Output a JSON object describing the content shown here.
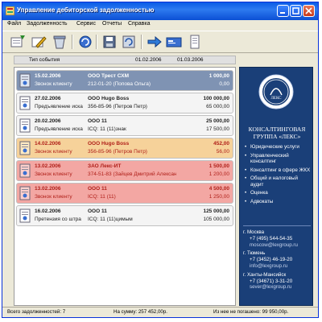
{
  "window": {
    "title": "Управление дебиторской задолженностью"
  },
  "menu": [
    "Файл",
    "Задолженность",
    "Сервис",
    "Отчеты",
    "Справка"
  ],
  "toolbar": {
    "icons": [
      "add-icon",
      "edit-icon",
      "delete-icon",
      "refresh-icon",
      "save-icon",
      "undo-icon",
      "export-icon",
      "card-icon",
      "print-icon"
    ]
  },
  "list_header": {
    "type_label": "Тип события",
    "date_from": "01.02.2006",
    "date_to": "01.03.2006"
  },
  "events": [
    {
      "date": "15.02.2006",
      "org": "ООО Трест СХМ",
      "amount": "1 000,00",
      "desc": "Звонок клиенту",
      "contact": "212-01-20 (Попова Ольга)",
      "amount2": "0,00",
      "status": "selected"
    },
    {
      "date": "27.02.2006",
      "org": "ООО Hugo Boss",
      "amount": "100 000,00",
      "desc": "Предъявление иска",
      "contact": "356-85-96 (Петров Петр)",
      "amount2": "65 000,00",
      "status": "normal"
    },
    {
      "date": "20.02.2006",
      "org": "ООО 11",
      "amount": "25 000,00",
      "desc": "Предъявление иска",
      "contact": "ICQ: 11 (11)знак",
      "amount2": "17 500,00",
      "status": "normal"
    },
    {
      "date": "14.02.2006",
      "org": "ООО Hugo Boss",
      "amount": "452,00",
      "desc": "Звонок клиенту",
      "contact": "356-85-96 (Петров Петр)",
      "amount2": "56,00",
      "status": "warning"
    },
    {
      "date": "13.02.2006",
      "org": "ЗАО Лекс-ИТ",
      "amount": "1 500,00",
      "desc": "Звонок клиенту",
      "contact": "374-51-83 (Зайцев Дмитрий Александро...",
      "amount2": "1 200,00",
      "status": "overdue"
    },
    {
      "date": "13.02.2006",
      "org": "ООО 11",
      "amount": "4 500,00",
      "desc": "Звонок клиенту",
      "contact": "ICQ: 11 (11)",
      "amount2": "1 250,00",
      "status": "overdue"
    },
    {
      "date": "16.02.2006",
      "org": "ООО 11",
      "amount": "125 000,00",
      "desc": "Претензия со штра",
      "contact": "ICQ: 11 (11)цимым",
      "amount2": "105 000,00",
      "status": "normal"
    }
  ],
  "sidebar": {
    "brand_line1": "КОНСАЛТИНГОВАЯ",
    "brand_line2": "ГРУППА «ЛЕКС»",
    "logo_text": "ЛЕКС",
    "services": [
      "Юридические услуги",
      "Управленческий консалтинг",
      "Консалтинг в сфере ЖКХ",
      "Общий и налоговый аудит",
      "Оценка",
      "Адвокаты"
    ],
    "offices": [
      {
        "city": "г. Москва",
        "phone": "+7 (495) 544-54-35",
        "email": "moscow@lexgroup.ru"
      },
      {
        "city": "г. Тюмень",
        "phone": "+7 (3452) 46-19-20",
        "email": "info@lexgroup.ru"
      },
      {
        "city": "г. Ханты-Мансийск",
        "phone": "+7 (34671) 3-31-20",
        "email": "sever@lexgroup.ru"
      }
    ]
  },
  "statusbar": {
    "total": "Всего задолженностей: 7",
    "sum": "На сумму: 257 452,00р.",
    "unpaid": "Из нее не погашено: 99 950,00р."
  },
  "colors": {
    "selected": "#7f93b3",
    "normal": "#f4f4f4",
    "warning": "#f6d29a",
    "overdue": "#f3a7a3",
    "sidebar": "#1a3f78"
  }
}
